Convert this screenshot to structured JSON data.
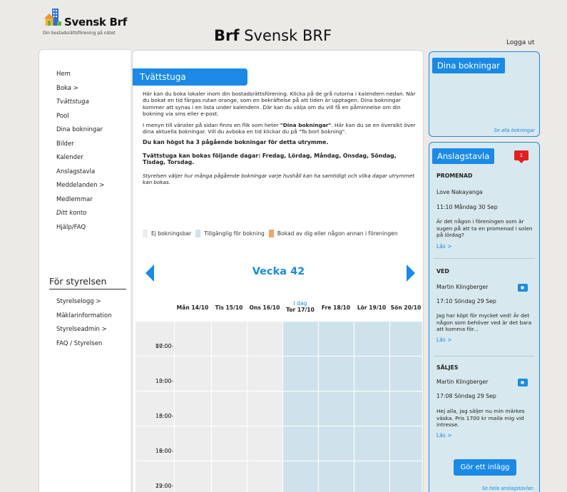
{
  "header": {
    "brand": "Svensk Brf",
    "tagline": "Din bostadsrättsförening på nätet",
    "title_bold": "Brf",
    "title_rest": "Svensk BRF",
    "logout": "Logga ut"
  },
  "sidebar": {
    "items": [
      "Hem",
      "Boka >",
      "Tvättstuga",
      "Pool",
      "Dina bokningar",
      "Bilder",
      "Kalender",
      "Anslagstavla",
      "Meddelanden >",
      "Medlemmar",
      "Ditt konto",
      "Hjälp/FAQ"
    ],
    "board_heading": "För styrelsen",
    "board_items": [
      "Styrelselogg >",
      "Mäklarinformation",
      "Styrelseadmin >",
      "FAQ / Styrelsen"
    ]
  },
  "main": {
    "title": "Tvättstuga",
    "intro_1": "Här kan du boka lokaler inom din bostadsrättsförening. Klicka på de grå rutorna i kalendern nedan. När du bokat en tid färgas rutan orange, som en bekräftelse på att tiden är upptagen. Dina bokningar kommer att synas i en lista under kalendern. Där kan du välja om du vill få en påminnelse om din bokning via sms eller e-post.",
    "intro_2a": "I menyn till vänster på sidan finns en flik som heter ",
    "intro_2b": "\"Dina bokningar\"",
    "intro_2c": ". Här kan du se en översikt över dina aktuella bokningar. Vill du avboka en tid klickar du på \"Ta bort bokning\".",
    "max_bookings": "Du kan högst ha 3 pågående bokningar för detta utrymme.",
    "days_info": "Tvättstuga kan bokas följande dagar: Fredag, Lördag, Måndag, Onsdag, Söndag, Tisdag, Torsdag.",
    "board_note": "Styrelsen väljer hur många pågående bokningar varje hushåll kan ha samtidigt och vilka dagar utrymmet kan bokas."
  },
  "legend": {
    "not_bookable": "Ej bokningsbar",
    "available": "Tillgänglig för bokning",
    "booked": "Bokad av dig eller någon annan i föreningen"
  },
  "calendar": {
    "week": "Vecka 42",
    "today_label": "I dag",
    "days": [
      "Mån 14/10",
      "Tis 15/10",
      "Ons 16/10",
      "Tor 17/10",
      "Fre 18/10",
      "Lör 19/10",
      "Sön 20/10"
    ],
    "slots": [
      {
        "start": "07:00-",
        "end": "10:00"
      },
      {
        "start": "10:00-",
        "end": "13:00"
      },
      {
        "start": "13:00-",
        "end": "16:00"
      },
      {
        "start": "16:00-",
        "end": "19:00"
      },
      {
        "start": "19:00-",
        "end": "22:00"
      }
    ]
  },
  "bookings_box": {
    "title": "Dina bokningar",
    "see_all": "Se alla bokningar"
  },
  "board_box": {
    "title": "Anslagstavla",
    "badge": "1",
    "posts": [
      {
        "title": "PROMENAD",
        "author": "Love Nakayanga",
        "time": "11:10 Måndag 30 Sep",
        "text": "Är det någon i föreningen som är sugen på att ta en promenad i solen på lördag?",
        "read": "Läs >"
      },
      {
        "title": "VED",
        "author": "Martin Klingberger",
        "time": "17:10 Söndag 29 Sep",
        "text": "Jag har köpt för mycket ved! Är det någon som behöver ved är det bara att komma för...",
        "read": "Läs >"
      },
      {
        "title": "SÄLJES",
        "author": "Martin Klingberger",
        "time": "17:08 Söndag 29 Sep",
        "text": "Hej alla, jag säljer nu min märkes väska. Pris 1700 kr maila mig vid intresse.",
        "read": "Läs >"
      }
    ],
    "cta": "Gör ett inlägg",
    "see_all": "Se hela anslagstavlan"
  },
  "colors": {
    "accent": "#1a8ae6",
    "not_bookable": "#ededed",
    "available": "#cfe2ec",
    "booked": "#f2a46a",
    "panel": "#d7e8ee"
  }
}
